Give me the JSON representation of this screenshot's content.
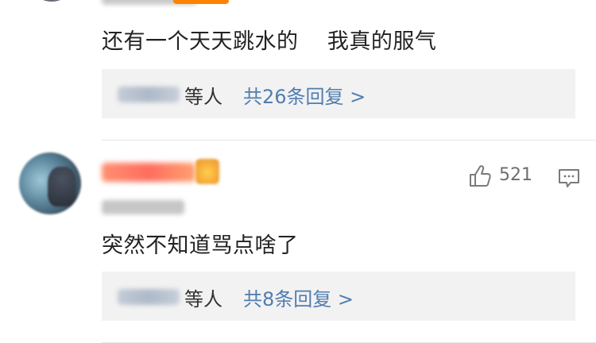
{
  "previous_comment": {
    "text": "还有一个天天跳水的    我真的服气",
    "replies": {
      "others_label": "等人",
      "more_link": "共26条回复 >"
    }
  },
  "comment": {
    "like_count": "521",
    "text": "突然不知道骂点啥了",
    "replies": {
      "others_label": "等人",
      "more_link": "共8条回复 >"
    }
  },
  "icons": {
    "like": "thumbs-up-icon",
    "reply": "comment-bubble-icon"
  },
  "colors": {
    "link": "#507daf",
    "reply_bg": "#f2f2f2",
    "meta": "#6e6e6e",
    "accent": "#ff8200"
  }
}
